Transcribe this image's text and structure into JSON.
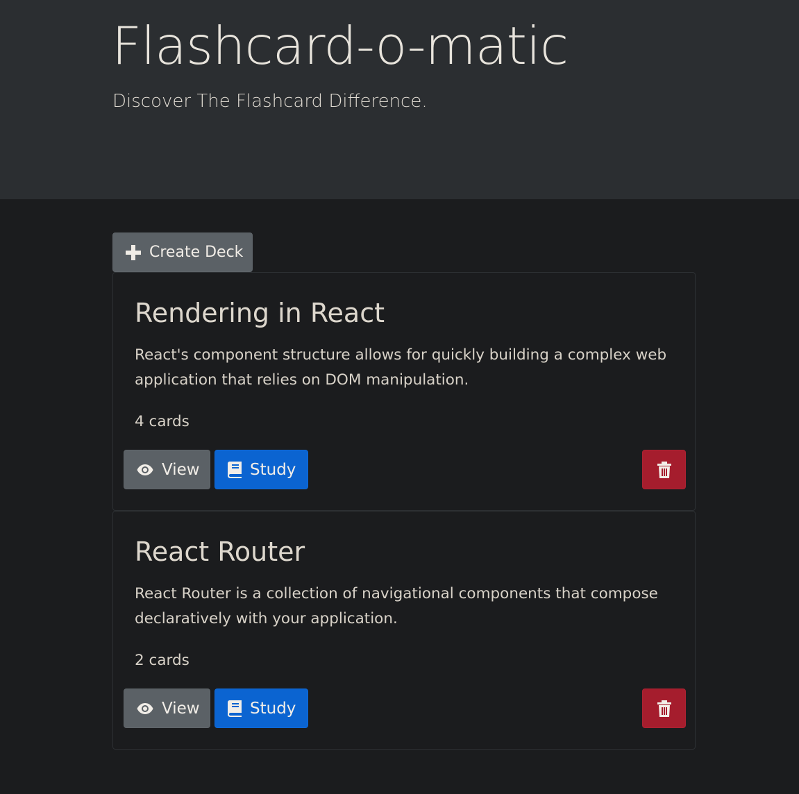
{
  "header": {
    "title": "Flashcard-o-matic",
    "subtitle": "Discover The Flashcard Difference."
  },
  "actions": {
    "create_deck_label": "Create Deck",
    "create_icon": "plus-icon"
  },
  "decks": [
    {
      "name": "Rendering in React",
      "description": "React's component structure allows for quickly building a complex web application that relies on DOM manipulation.",
      "card_count": "4 cards",
      "view_label": "View",
      "study_label": "Study"
    },
    {
      "name": "React Router",
      "description": "React Router is a collection of navigational components that compose declaratively with your application.",
      "card_count": "2 cards",
      "view_label": "View",
      "study_label": "Study"
    }
  ],
  "icons": {
    "view": "eye-icon",
    "study": "book-icon",
    "delete": "trash-icon"
  },
  "colors": {
    "header_bg": "#2b2e31",
    "page_bg": "#1b1c1e",
    "secondary_button": "#5b6166",
    "primary_button": "#0b64d1",
    "danger_button": "#a51d2d"
  }
}
